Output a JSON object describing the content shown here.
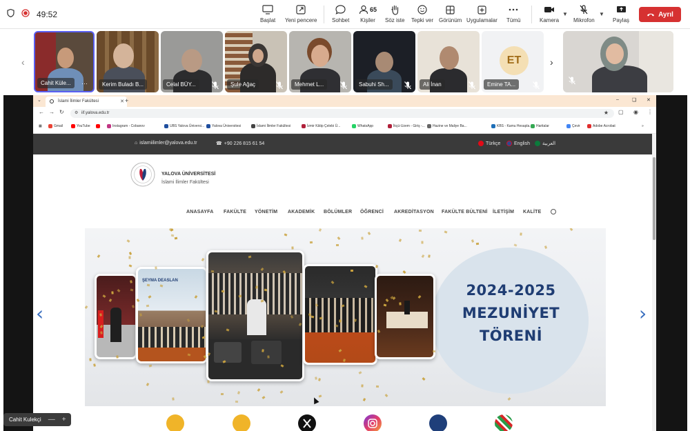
{
  "toolbar": {
    "timer": "49:52",
    "start": "Başlat",
    "new_window": "Yeni pencere",
    "chat": "Sohbet",
    "people_count": "65",
    "people": "Kişiler",
    "request": "Söz iste",
    "react": "Tepki ver",
    "view": "Görünüm",
    "apps": "Uygulamalar",
    "more": "Tümü",
    "camera": "Kamera",
    "mic": "Mikrofon",
    "share": "Paylaş",
    "leave": "Ayrıl"
  },
  "participants": [
    {
      "name": "Cahit Küle...",
      "muted": false
    },
    {
      "name": "Kerim Buladı B...",
      "muted": true
    },
    {
      "name": "Celal BÜY...",
      "muted": true
    },
    {
      "name": "Şule Ağaç",
      "muted": true
    },
    {
      "name": "Mehmet L...",
      "muted": true
    },
    {
      "name": "Sabuhi Sh...",
      "muted": true
    },
    {
      "name": "Ali İnan",
      "muted": true
    },
    {
      "name": "Emine TA...",
      "muted": true,
      "initials": "ET"
    },
    {
      "name": "",
      "muted": true
    }
  ],
  "browser": {
    "tab_title": "İslami İlimler Fakültesi",
    "url": "iif.yalova.edu.tr",
    "bookmarks": [
      {
        "label": "Gmail",
        "color": "#ea4335"
      },
      {
        "label": "YouTube",
        "color": "#ff0000"
      },
      {
        "label": "",
        "color": "#ff0000"
      },
      {
        "label": "Instagram - Cobanov",
        "color": "#c13584"
      },
      {
        "label": "UBS Yalova Üniversi...",
        "color": "#1f4e9e"
      },
      {
        "label": "Yalova Üniversitesi",
        "color": "#1f4e9e"
      },
      {
        "label": "İslami İlimler Fakültesi",
        "color": "#444444"
      },
      {
        "label": "İzmir Kâtip Çelebi Ü...",
        "color": "#b0203a"
      },
      {
        "label": "WhatsApp",
        "color": "#25d366"
      },
      {
        "label": "İkçü-Uzem - Giriş -...",
        "color": "#b0203a"
      },
      {
        "label": "Hazine ve Maliye Ba...",
        "color": "#666666"
      },
      {
        "label": "KBS - Kamu Hesapla...",
        "color": "#1e6fb8"
      },
      {
        "label": "Haritalar",
        "color": "#34a853"
      },
      {
        "label": "Çevir",
        "color": "#4285f4"
      },
      {
        "label": "Adobe Acrobat",
        "color": "#e02e2e"
      }
    ]
  },
  "site": {
    "email": "islamiilimler@yalova.edu.tr",
    "phone": "+90 226 815 61 54",
    "lang_tr": "Türkçe",
    "lang_en": "English",
    "lang_ar": "العربية",
    "university": "YALOVA ÜNİVERSİTESİ",
    "faculty": "İslami İlimler Fakültesi",
    "menu": [
      "ANASAYFA",
      "FAKÜLTE",
      "YÖNETİM",
      "AKADEMİK",
      "BÖLÜMLER",
      "ÖĞRENCİ",
      "AKREDİTASYON",
      "FAKÜLTE BÜLTENİ",
      "İLETİŞİM",
      "KALİTE"
    ],
    "banner_line1": "2024-2025",
    "banner_line2": "MEZUNİYET",
    "banner_line3": "TÖRENİ",
    "banner_sign": "ŞEYMA DEASLAN"
  },
  "self_view": {
    "name": "Cahit Kulekçi"
  },
  "colors": {
    "leave": "#d63131",
    "banner_text": "#1f3d73",
    "topbar_site": "#3a3a3a",
    "tab_strip": "#fbe7d3"
  }
}
